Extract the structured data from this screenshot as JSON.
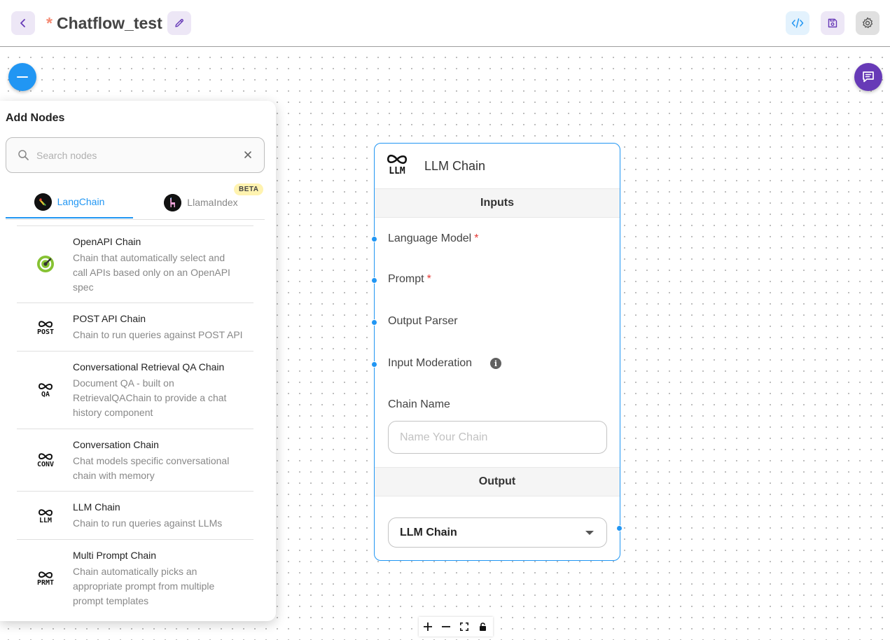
{
  "header": {
    "modified_marker": "*",
    "title": "Chatflow_test"
  },
  "panel": {
    "title": "Add Nodes",
    "search_placeholder": "Search nodes",
    "tabs": [
      {
        "label": "LangChain",
        "active": true
      },
      {
        "label": "LlamaIndex",
        "active": false,
        "badge": "BETA"
      }
    ],
    "items": [
      {
        "name": "OpenAPI Chain",
        "description": "Chain that automatically select and call APIs based only on an OpenAPI spec",
        "icon": "openapi-icon"
      },
      {
        "name": "POST API Chain",
        "description": "Chain to run queries against POST API",
        "icon_text": "POST"
      },
      {
        "name": "Conversational Retrieval QA Chain",
        "description": "Document QA - built on RetrievalQAChain to provide a chat history component",
        "icon_text": "QA"
      },
      {
        "name": "Conversation Chain",
        "description": "Chat models specific conversational chain with memory",
        "icon_text": "CONV"
      },
      {
        "name": "LLM Chain",
        "description": "Chain to run queries against LLMs",
        "icon_text": "LLM"
      },
      {
        "name": "Multi Prompt Chain",
        "description": "Chain automatically picks an appropriate prompt from multiple prompt templates",
        "icon_text": "PRMT"
      }
    ]
  },
  "node": {
    "title": "LLM Chain",
    "logo_text": "LLM",
    "inputs_label": "Inputs",
    "inputs": [
      {
        "label": "Language Model",
        "required": "*"
      },
      {
        "label": "Prompt",
        "required": "*"
      },
      {
        "label": "Output Parser"
      },
      {
        "label": "Input Moderation"
      }
    ],
    "chain_name_label": "Chain Name",
    "chain_name_placeholder": "Name Your Chain",
    "output_label": "Output",
    "output_value": "LLM Chain"
  },
  "colors": {
    "accent": "#2196f3",
    "purple": "#673ab7",
    "required": "#e53935"
  }
}
